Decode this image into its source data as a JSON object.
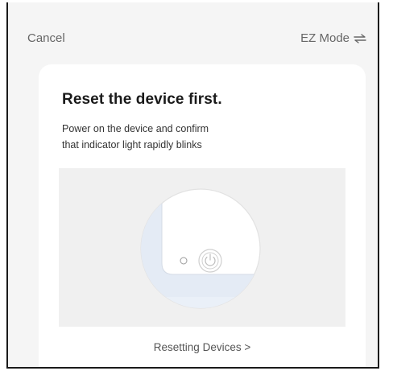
{
  "header": {
    "cancel_label": "Cancel",
    "mode_label": "EZ Mode",
    "mode_icon": "swap-arrows-icon"
  },
  "card": {
    "title": "Reset the device first.",
    "description_line1": "Power on the device and confirm",
    "description_line2": "that indicator light rapidly blinks",
    "illustration_icon": "device-power-button-illustration",
    "link_label": "Resetting Devices >"
  }
}
